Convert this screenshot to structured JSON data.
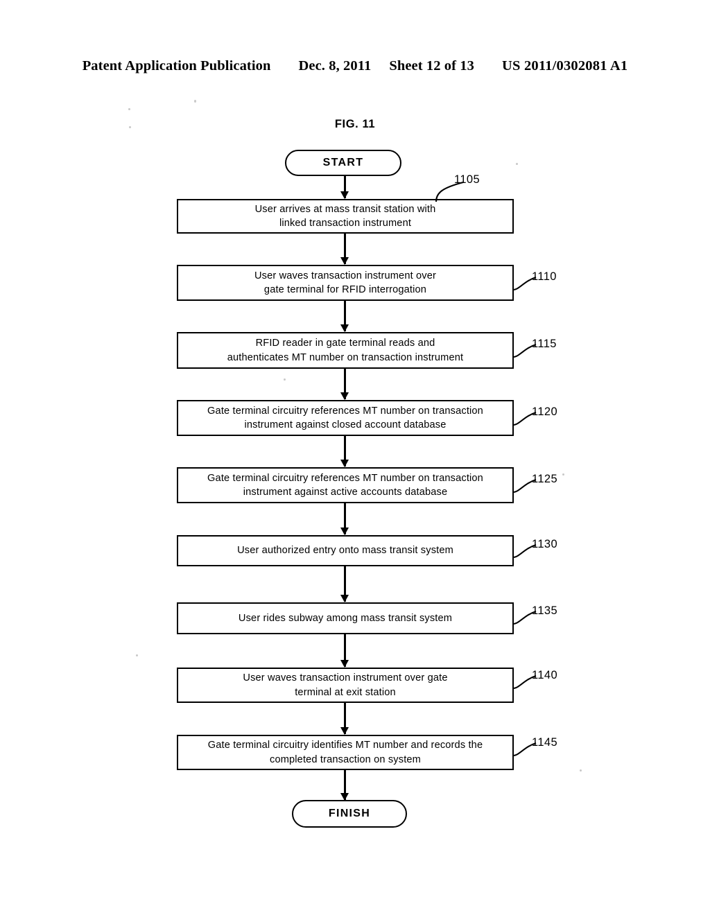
{
  "header": {
    "publication": "Patent Application Publication",
    "date": "Dec. 8, 2011",
    "sheet": "Sheet 12 of 13",
    "patent_number": "US 2011/0302081 A1"
  },
  "figure": {
    "title": "FIG. 11",
    "start_label": "START",
    "finish_label": "FINISH",
    "steps": [
      {
        "ref": "1105",
        "line1": "User arrives at mass transit station with",
        "line2": "linked transaction instrument"
      },
      {
        "ref": "1110",
        "line1": "User waves transaction instrument over",
        "line2": "gate terminal for RFID interrogation"
      },
      {
        "ref": "1115",
        "line1": "RFID reader in gate terminal reads and",
        "line2": "authenticates MT number on transaction instrument"
      },
      {
        "ref": "1120",
        "line1": "Gate terminal circuitry references MT number on transaction",
        "line2": "instrument against closed account database"
      },
      {
        "ref": "1125",
        "line1": "Gate terminal circuitry references MT number on transaction",
        "line2": "instrument against active accounts database"
      },
      {
        "ref": "1130",
        "line1": "User authorized entry onto mass transit system",
        "line2": ""
      },
      {
        "ref": "1135",
        "line1": "User rides subway among mass transit system",
        "line2": ""
      },
      {
        "ref": "1140",
        "line1": "User waves transaction instrument over gate",
        "line2": "terminal at exit station"
      },
      {
        "ref": "1145",
        "line1": "Gate terminal circuitry identifies MT number and records the",
        "line2": "completed transaction on system"
      }
    ]
  }
}
